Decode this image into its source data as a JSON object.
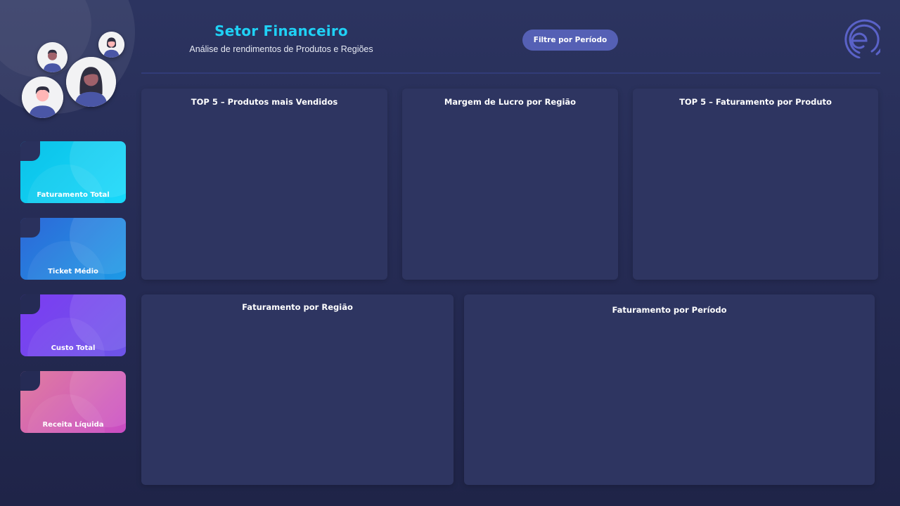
{
  "header": {
    "title": "Setor Financeiro",
    "subtitle": "Análise de rendimentos de Produtos e Regiões",
    "filter_button_label": "Filtre por Período",
    "logo_icon": "brand-logo-icon"
  },
  "colors": {
    "background": "#262c55",
    "title_accent": "#1fd1f5",
    "filter_button": "#5560b5",
    "panel": "#2e3561"
  },
  "kpis": [
    {
      "label": "Faturamento Total",
      "color": "#17d9fb"
    },
    {
      "label": "Ticket Médio",
      "color": "#1c9ae6"
    },
    {
      "label": "Custo Total",
      "color": "#7c3cf2"
    },
    {
      "label": "Receita Líquida",
      "color": "#c94bc4"
    }
  ],
  "panels": {
    "top_produtos": {
      "title": "TOP 5 – Produtos mais Vendidos"
    },
    "margem_lucro": {
      "title": "Margem de Lucro por Região"
    },
    "top_faturamento": {
      "title": "TOP 5 – Faturamento por Produto"
    },
    "faturamento_regiao": {
      "title": "Faturamento por Região"
    },
    "faturamento_periodo": {
      "title": "Faturamento por Período"
    }
  },
  "avatars": [
    "avatar-man-icon",
    "avatar-woman-icon",
    "avatar-woman-long-hair-icon",
    "avatar-man-2-icon"
  ]
}
